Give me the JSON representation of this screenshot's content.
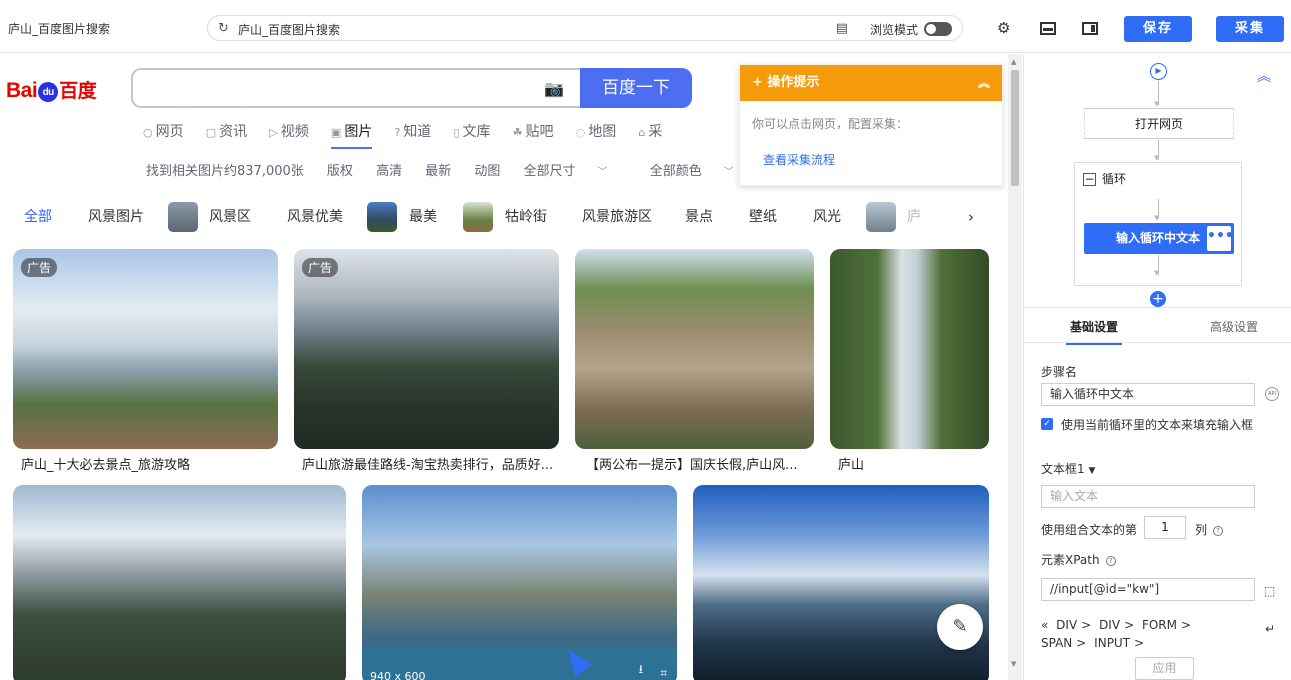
{
  "window": {
    "title": "庐山_百度图片搜索"
  },
  "addressbar": {
    "url": "庐山_百度图片搜索",
    "browse_mode_label": "浏览模式",
    "reload_icon": "reload-icon",
    "page_icon": "page-icon"
  },
  "toolbar": {
    "save_label": "保存",
    "collect_label": "采集",
    "settings_icon": "gear-icon",
    "accent": "#2f6df6"
  },
  "baidu": {
    "logo_text_left": "Bai",
    "logo_text_paw": "du",
    "logo_text_cn": "百度",
    "search_value": "",
    "search_button": "百度一下",
    "nav_tabs": [
      {
        "label": "网页",
        "icon": "search-icon"
      },
      {
        "label": "资讯",
        "icon": "news-icon"
      },
      {
        "label": "视频",
        "icon": "video-icon"
      },
      {
        "label": "图片",
        "icon": "image-icon"
      },
      {
        "label": "知道",
        "icon": "question-icon"
      },
      {
        "label": "文库",
        "icon": "doc-icon"
      },
      {
        "label": "贴吧",
        "icon": "paw-icon"
      },
      {
        "label": "地图",
        "icon": "map-icon"
      },
      {
        "label": "采",
        "icon": "bag-icon"
      }
    ],
    "active_tab": "图片",
    "filters": [
      "找到相关图片约837,000张",
      "版权",
      "高清",
      "最新",
      "动图",
      "全部尺寸",
      "全部颜色"
    ],
    "tags": [
      "全部",
      "风景图片",
      "风景区",
      "风景优美",
      "最美",
      "牯岭街",
      "风景旅游区",
      "景点",
      "壁纸",
      "风光",
      "庐"
    ],
    "results": [
      {
        "caption": "庐山_十大必去景点_旅游攻略",
        "ad": "广告"
      },
      {
        "caption": "庐山旅游最佳路线-淘宝热卖排行，品质好...",
        "ad": "广告"
      },
      {
        "caption": "【两公布一提示】国庆长假,庐山风...",
        "ad": ""
      },
      {
        "caption": "庐山",
        "ad": ""
      },
      {
        "caption": "",
        "ad": ""
      },
      {
        "caption": "",
        "ad": "",
        "dimensions": "940 x 600"
      },
      {
        "caption": "",
        "ad": ""
      }
    ]
  },
  "tip_panel": {
    "title": "操作提示",
    "text": "你可以点击网页，配置采集：",
    "link": "查看采集流程",
    "color": "#f59a0a"
  },
  "flow": {
    "open_page": "打开网页",
    "loop": "循环",
    "input_node": "输入循环中文本"
  },
  "settings": {
    "tab_basic": "基础设置",
    "tab_advanced": "高级设置",
    "step_name_label": "步骤名",
    "step_name_value": "输入循环中文本",
    "use_loop_text": "使用当前循环里的文本来填充输入框",
    "textbox_label": "文本框1",
    "text_input_placeholder": "输入文本",
    "combo_prefix": "使用组合文本的第",
    "combo_value": "1",
    "combo_suffix": "列",
    "xpath_label": "元素XPath",
    "xpath_value": "//input[@id=\"kw\"]",
    "breadcrumb": [
      "DIV",
      "DIV",
      "FORM",
      "SPAN",
      "INPUT"
    ],
    "apply": "应用"
  }
}
